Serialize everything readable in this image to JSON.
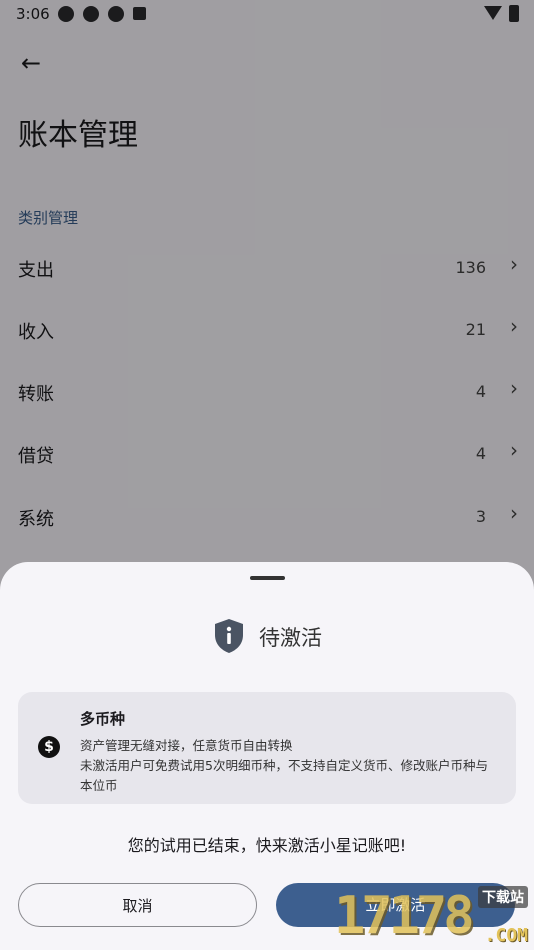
{
  "status_bar": {
    "time": "3:06"
  },
  "header": {
    "back_icon": "arrow-left-icon",
    "title": "账本管理"
  },
  "section": {
    "label": "类别管理"
  },
  "categories": [
    {
      "label": "支出",
      "count": "136"
    },
    {
      "label": "收入",
      "count": "21"
    },
    {
      "label": "转账",
      "count": "4"
    },
    {
      "label": "借贷",
      "count": "4"
    },
    {
      "label": "系统",
      "count": "3"
    }
  ],
  "sheet": {
    "title": "待激活",
    "feature": {
      "title": "多币种",
      "desc_line1": "资产管理无缝对接，任意货币自由转换",
      "desc_line2": "未激活用户可免费试用5次明细币种，不支持自定义货币、修改账户币种与本位币"
    },
    "message": "您的试用已结束，快来激活小星记账吧!",
    "cancel_label": "取消",
    "activate_label": "立即激活"
  },
  "watermark": {
    "number": "17178",
    "tag": "下载站",
    "domain": ".COM"
  },
  "colors": {
    "accent": "#3d5f8f",
    "section_header": "#3b5f8c",
    "sheet_bg": "#f6f5f9"
  }
}
